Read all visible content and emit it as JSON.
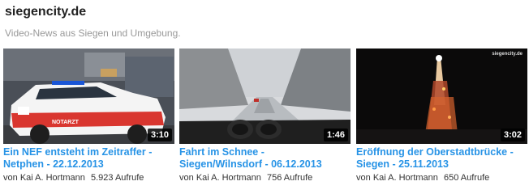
{
  "channel": {
    "title": "siegencity.de",
    "description": "Video-News aus Siegen und Umgebung."
  },
  "videos": [
    {
      "title_line1": "Ein NEF entsteht im Zeitraffer -",
      "title_line2": "Netphen - 22.12.2013",
      "duration": "3:10",
      "by": "von",
      "author": "Kai A. Hortmann",
      "views": "5.923 Aufrufe",
      "vehicle_text": "NOTARZT"
    },
    {
      "title_line1": "Fahrt im Schnee -",
      "title_line2": "Siegen/Wilnsdorf - 06.12.2013",
      "duration": "1:46",
      "by": "von",
      "author": "Kai A. Hortmann",
      "views": "756 Aufrufe"
    },
    {
      "title_line1": "Eröffnung der Oberstadtbrücke -",
      "title_line2": "Siegen - 25.11.2013",
      "duration": "3:02",
      "by": "von",
      "author": "Kai A. Hortmann",
      "views": "650 Aufrufe",
      "watermark": "siegencity.de"
    }
  ]
}
